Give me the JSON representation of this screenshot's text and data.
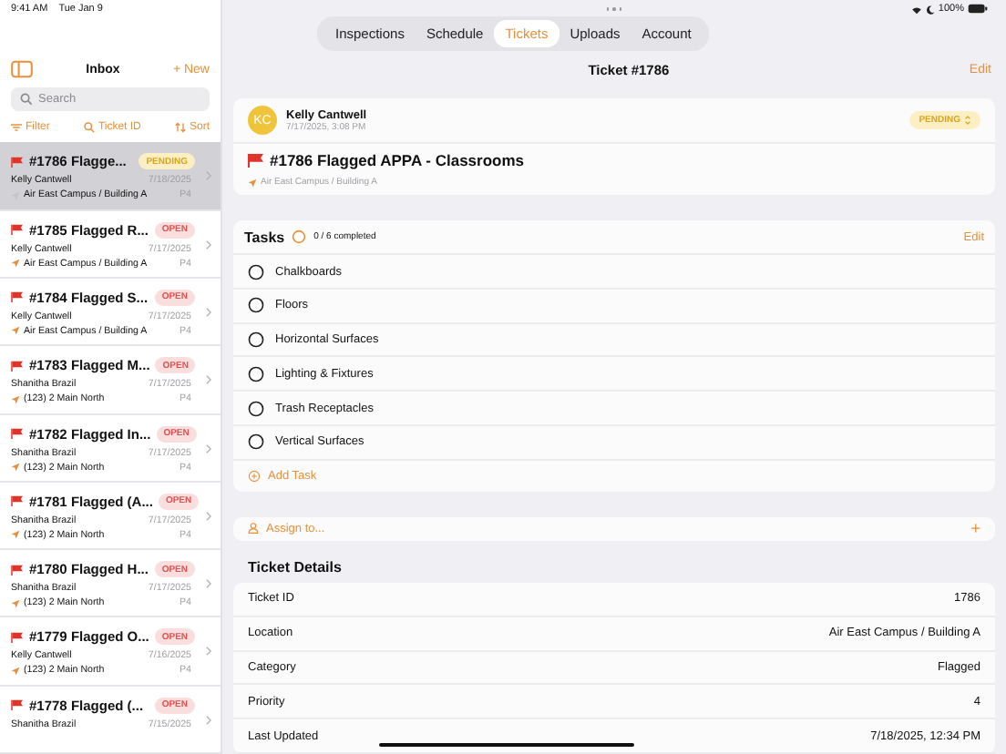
{
  "status_bar": {
    "time": "9:41 AM",
    "date": "Tue Jan 9",
    "battery": "100%"
  },
  "sidebar": {
    "title": "Inbox",
    "new_label": "+ New",
    "search": {
      "placeholder": "Search"
    },
    "toolbar": [
      "Filter",
      "Ticket ID",
      "Sort"
    ],
    "tickets": [
      {
        "title": "#1786 Flagge...",
        "status": "PENDING",
        "kind": "pending",
        "person": "Kelly Cantwell",
        "date": "7/18/2025",
        "location": "Air East Campus / Building A",
        "priority": "P4",
        "selected": true
      },
      {
        "title": "#1785 Flagged R...",
        "status": "OPEN",
        "kind": "open",
        "person": "Kelly Cantwell",
        "date": "7/17/2025",
        "location": "Air East Campus / Building A",
        "priority": "P4",
        "selected": false
      },
      {
        "title": "#1784 Flagged S...",
        "status": "OPEN",
        "kind": "open",
        "person": "Kelly Cantwell",
        "date": "7/17/2025",
        "location": "Air East Campus / Building A",
        "priority": "P4",
        "selected": false
      },
      {
        "title": "#1783 Flagged M...",
        "status": "OPEN",
        "kind": "open",
        "person": "Shanitha Brazil",
        "date": "7/17/2025",
        "location": "(123) 2 Main North",
        "priority": "P4",
        "selected": false
      },
      {
        "title": "#1782 Flagged In...",
        "status": "OPEN",
        "kind": "open",
        "person": "Shanitha Brazil",
        "date": "7/17/2025",
        "location": "(123) 2 Main North",
        "priority": "P4",
        "selected": false
      },
      {
        "title": "#1781 Flagged (A...",
        "status": "OPEN",
        "kind": "open",
        "person": "Shanitha Brazil",
        "date": "7/17/2025",
        "location": "(123) 2 Main North",
        "priority": "P4",
        "selected": false
      },
      {
        "title": "#1780 Flagged H...",
        "status": "OPEN",
        "kind": "open",
        "person": "Shanitha Brazil",
        "date": "7/17/2025",
        "location": "(123) 2 Main North",
        "priority": "P4",
        "selected": false
      },
      {
        "title": "#1779 Flagged O...",
        "status": "OPEN",
        "kind": "open",
        "person": "Kelly Cantwell",
        "date": "7/16/2025",
        "location": "(123) 2 Main North",
        "priority": "P4",
        "selected": false
      },
      {
        "title": "#1778 Flagged (...",
        "status": "OPEN",
        "kind": "open",
        "person": "Shanitha Brazil",
        "date": "7/15/2025",
        "selected": false
      }
    ]
  },
  "tabs": [
    {
      "label": "Inspections",
      "selected": false
    },
    {
      "label": "Schedule",
      "selected": false
    },
    {
      "label": "Tickets",
      "selected": true
    },
    {
      "label": "Uploads",
      "selected": false
    },
    {
      "label": "Account",
      "selected": false
    }
  ],
  "detail": {
    "title": "Ticket #1786",
    "edit": "Edit",
    "header": {
      "initials": "KC",
      "name": "Kelly Cantwell",
      "timestamp": "7/17/2025, 3:08 PM",
      "status": "PENDING",
      "kind": "pending",
      "ticket_title": "#1786 Flagged APPA - Classrooms",
      "location": "Air East Campus / Building A"
    },
    "tasks": {
      "title": "Tasks",
      "progress": "0 / 6 completed",
      "edit": "Edit",
      "items": [
        {
          "label": "Chalkboards",
          "checked": false
        },
        {
          "label": "Floors",
          "checked": false
        },
        {
          "label": "Horizontal Surfaces",
          "checked": false
        },
        {
          "label": "Lighting & Fixtures",
          "checked": false
        },
        {
          "label": "Trash Receptacles",
          "checked": false
        },
        {
          "label": "Vertical Surfaces",
          "checked": false
        }
      ],
      "add": "Add Task"
    },
    "assign": {
      "label": "Assign to...",
      "action": "+"
    },
    "details": {
      "title": "Ticket Details",
      "rows": [
        {
          "label": "Ticket ID",
          "value": "1786"
        },
        {
          "label": "Location",
          "value": "Air East Campus / Building A"
        },
        {
          "label": "Category",
          "value": "Flagged"
        },
        {
          "label": "Priority",
          "value": "4"
        },
        {
          "label": "Last Updated",
          "value": "7/18/2025, 12:34 PM"
        }
      ]
    }
  }
}
